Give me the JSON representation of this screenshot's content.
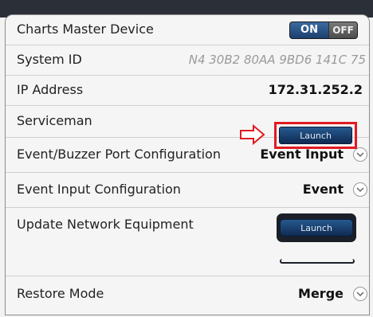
{
  "rows": {
    "charts_master": {
      "label": "Charts Master Device",
      "toggle_on": "ON",
      "toggle_off": "OFF"
    },
    "system_id": {
      "label": "System ID",
      "value": "N4 30B2 80AA 9BD6 141C 75"
    },
    "ip_address": {
      "label": "IP Address",
      "value": "172.31.252.2"
    },
    "serviceman": {
      "label": "Serviceman",
      "button": "Launch"
    },
    "event_buzzer": {
      "label": "Event/Buzzer Port Configuration",
      "value": "Event Input"
    },
    "event_input": {
      "label": "Event Input Configuration",
      "value": "Event"
    },
    "update_network": {
      "label": "Update Network Equipment",
      "button": "Launch"
    },
    "restore_mode": {
      "label": "Restore Mode",
      "value": "Merge"
    }
  },
  "icons": {
    "dropdown": "chevron-down-icon",
    "pointer": "arrow-right-icon"
  },
  "colors": {
    "highlight": "#e11b22",
    "button": "#1c3f6e"
  }
}
